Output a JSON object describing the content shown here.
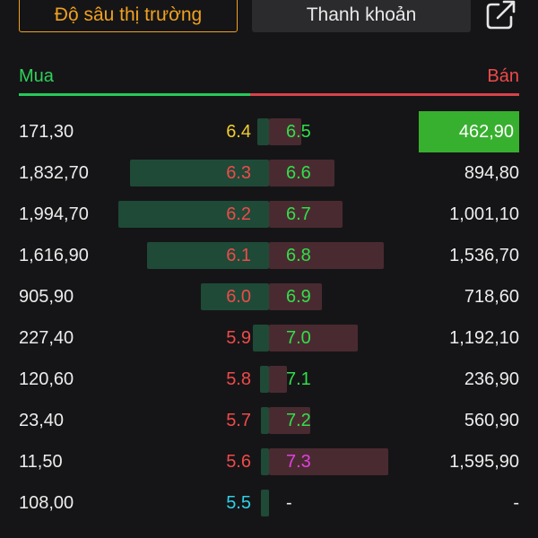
{
  "tabs": {
    "market_depth": "Độ sâu thị trường",
    "liquidity": "Thanh khoản"
  },
  "share_icon": "share-icon",
  "header": {
    "buy": "Mua",
    "sell": "Bán"
  },
  "colors": {
    "ceiling": "#e040e0",
    "up": "#2fe04a",
    "reference": "#f0cc30",
    "down": "#ef4a4a",
    "floor": "#2fd0e8",
    "accent": "#f0a020"
  },
  "book": [
    {
      "bid_vol": "171,30",
      "bid_px": "6.4",
      "bid_color": "reference",
      "bid_depth": 0.08,
      "ask_px": "6.5",
      "ask_color": "up",
      "ask_depth": 0.21,
      "ask_vol": "462,90",
      "ask_highlight": true
    },
    {
      "bid_vol": "1,832,70",
      "bid_px": "6.3",
      "bid_color": "down",
      "bid_depth": 0.92,
      "ask_px": "6.6",
      "ask_color": "up",
      "ask_depth": 0.43,
      "ask_vol": "894,80",
      "ask_highlight": false
    },
    {
      "bid_vol": "1,994,70",
      "bid_px": "6.2",
      "bid_color": "down",
      "bid_depth": 1.0,
      "ask_px": "6.7",
      "ask_color": "up",
      "ask_depth": 0.48,
      "ask_vol": "1,001,10",
      "ask_highlight": false
    },
    {
      "bid_vol": "1,616,90",
      "bid_px": "6.1",
      "bid_color": "down",
      "bid_depth": 0.81,
      "ask_px": "6.8",
      "ask_color": "up",
      "ask_depth": 0.75,
      "ask_vol": "1,536,70",
      "ask_highlight": false
    },
    {
      "bid_vol": "905,90",
      "bid_px": "6.0",
      "bid_color": "down",
      "bid_depth": 0.45,
      "ask_px": "6.9",
      "ask_color": "up",
      "ask_depth": 0.35,
      "ask_vol": "718,60",
      "ask_highlight": false
    },
    {
      "bid_vol": "227,40",
      "bid_px": "5.9",
      "bid_color": "down",
      "bid_depth": 0.11,
      "ask_px": "7.0",
      "ask_color": "up",
      "ask_depth": 0.58,
      "ask_vol": "1,192,10",
      "ask_highlight": false
    },
    {
      "bid_vol": "120,60",
      "bid_px": "5.8",
      "bid_color": "down",
      "bid_depth": 0.06,
      "ask_px": "7.1",
      "ask_color": "up",
      "ask_depth": 0.12,
      "ask_vol": "236,90",
      "ask_highlight": false
    },
    {
      "bid_vol": "23,40",
      "bid_px": "5.7",
      "bid_color": "down",
      "bid_depth": 0.02,
      "ask_px": "7.2",
      "ask_color": "up",
      "ask_depth": 0.27,
      "ask_vol": "560,90",
      "ask_highlight": false
    },
    {
      "bid_vol": "11,50",
      "bid_px": "5.6",
      "bid_color": "down",
      "bid_depth": 0.01,
      "ask_px": "7.3",
      "ask_color": "ceiling",
      "ask_depth": 0.78,
      "ask_vol": "1,595,90",
      "ask_highlight": false
    },
    {
      "bid_vol": "108,00",
      "bid_px": "5.5",
      "bid_color": "floor",
      "bid_depth": 0.05,
      "ask_px": "-",
      "ask_color": "none",
      "ask_depth": 0,
      "ask_vol": "-",
      "ask_highlight": false
    }
  ]
}
